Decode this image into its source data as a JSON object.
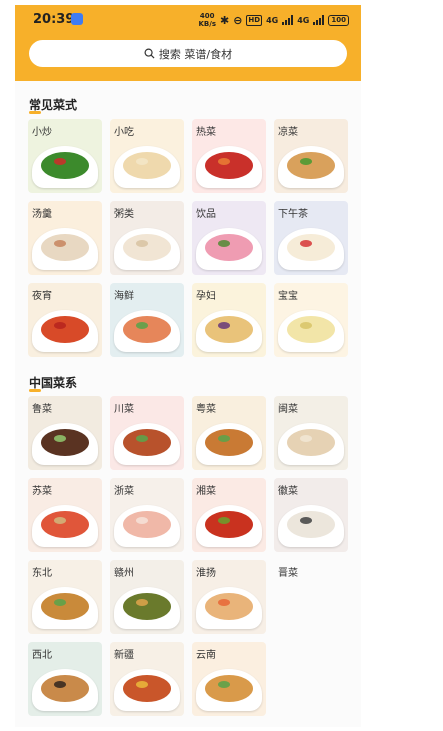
{
  "status_bar": {
    "time": "20:39",
    "net_speed": "400\nKB/s",
    "network": "4G",
    "battery": "100"
  },
  "search": {
    "placeholder": "搜索 菜谱/食材"
  },
  "sections": [
    {
      "title": "常见菜式",
      "items": [
        {
          "label": "小炒",
          "bg": "#eef3df",
          "food": "#3c8a2c",
          "acc": "#c8302a"
        },
        {
          "label": "小吃",
          "bg": "#fbf1de",
          "food": "#efd9ad",
          "acc": "#f3e5c7"
        },
        {
          "label": "热菜",
          "bg": "#fde8e6",
          "food": "#c9302a",
          "acc": "#e87a34"
        },
        {
          "label": "凉菜",
          "bg": "#f7ecdf",
          "food": "#d9a15c",
          "acc": "#4d9a33"
        },
        {
          "label": "汤羹",
          "bg": "#fbefdd",
          "food": "#e8d8c2",
          "acc": "#c98a64"
        },
        {
          "label": "粥类",
          "bg": "#f3ece6",
          "food": "#f1e5d4",
          "acc": "#d9c4a4"
        },
        {
          "label": "饮品",
          "bg": "#eee8f3",
          "food": "#ef9cb2",
          "acc": "#5a8c3b"
        },
        {
          "label": "下午茶",
          "bg": "#e6e9f3",
          "food": "#f6ecd8",
          "acc": "#d84040"
        },
        {
          "label": "夜宵",
          "bg": "#f9efdf",
          "food": "#d84a28",
          "acc": "#b8261e"
        },
        {
          "label": "海鲜",
          "bg": "#e3eef0",
          "food": "#e6865a",
          "acc": "#5ea24a"
        },
        {
          "label": "孕妇",
          "bg": "#fbf3dc",
          "food": "#e9c37a",
          "acc": "#6f3f7a"
        },
        {
          "label": "宝宝",
          "bg": "#fdf4e3",
          "food": "#f2e5a8",
          "acc": "#d9c56a"
        }
      ]
    },
    {
      "title": "中国菜系",
      "items": [
        {
          "label": "鲁菜",
          "bg": "#f2ebe0",
          "food": "#5a3322",
          "acc": "#8fc06a"
        },
        {
          "label": "川菜",
          "bg": "#fbe8e6",
          "food": "#b8522c",
          "acc": "#5ea24a"
        },
        {
          "label": "粤菜",
          "bg": "#f9efde",
          "food": "#c97a34",
          "acc": "#5ea24a"
        },
        {
          "label": "闽菜",
          "bg": "#f3efe6",
          "food": "#e6d2b4",
          "acc": "#f1e6d3"
        },
        {
          "label": "苏菜",
          "bg": "#f9ece4",
          "food": "#e0563a",
          "acc": "#d2b27a"
        },
        {
          "label": "浙菜",
          "bg": "#f6f0ea",
          "food": "#f0b8a8",
          "acc": "#f5e0d6"
        },
        {
          "label": "湘菜",
          "bg": "#fbeae4",
          "food": "#c9321f",
          "acc": "#6e9a2c"
        },
        {
          "label": "徽菜",
          "bg": "#f2ecea",
          "food": "#ece6dc",
          "acc": "#4a4a4a"
        },
        {
          "label": "东北",
          "bg": "#f7f0e6",
          "food": "#c98a3a",
          "acc": "#5ea24a"
        },
        {
          "label": "赣州",
          "bg": "#f3efe8",
          "food": "#6a7a2c",
          "acc": "#d9a24a"
        },
        {
          "label": "淮扬",
          "bg": "#f7efe6",
          "food": "#e9b47a",
          "acc": "#e86a3a"
        },
        {
          "label": "晋菜",
          "bg": "#fbfbfb",
          "food": "#fbfbfb",
          "acc": "#fbfbfb",
          "empty": true
        },
        {
          "label": "西北",
          "bg": "#e4eee8",
          "food": "#c98a4a",
          "acc": "#3a2a20"
        },
        {
          "label": "新疆",
          "bg": "#f7f0e6",
          "food": "#c9562a",
          "acc": "#e9b43a"
        },
        {
          "label": "云南",
          "bg": "#fbefe0",
          "food": "#d99a4a",
          "acc": "#5ea24a"
        }
      ]
    }
  ]
}
